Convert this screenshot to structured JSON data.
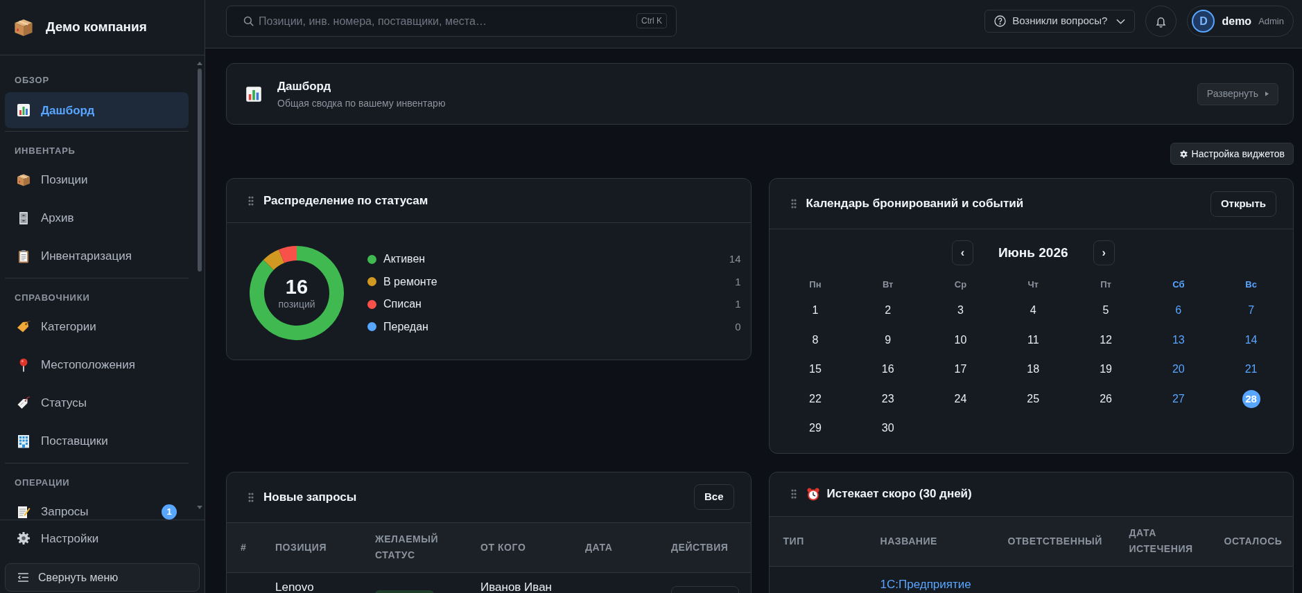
{
  "sidebar": {
    "brand": "Демо компания",
    "sections": [
      {
        "title": "ОБЗОР",
        "items": [
          {
            "label": "Дашборд",
            "selected": true
          }
        ]
      },
      {
        "title": "ИНВЕНТАРЬ",
        "items": [
          {
            "label": "Позиции",
            "selected": false
          },
          {
            "label": "Архив",
            "selected": false
          },
          {
            "label": "Инвентаризация",
            "selected": false
          }
        ]
      },
      {
        "title": "СПРАВОЧНИКИ",
        "items": [
          {
            "label": "Категории",
            "selected": false
          },
          {
            "label": "Местоположения",
            "selected": false
          },
          {
            "label": "Статусы",
            "selected": false
          },
          {
            "label": "Поставщики",
            "selected": false
          }
        ]
      },
      {
        "title": "ОПЕРАЦИИ",
        "items": [
          {
            "label": "Запросы",
            "selected": false,
            "badge": "1"
          }
        ]
      }
    ],
    "settings": {
      "label": "Настройки",
      "selected": false
    },
    "collapse_button": "Свернуть меню"
  },
  "top_bar": {
    "search": {
      "placeholder": "Позиции, инв. номера, поставщики, места…",
      "shortcut": "Ctrl K"
    },
    "help_button": "Возникли вопросы?",
    "user": {
      "initial": "D",
      "name": "demo",
      "role": "Admin"
    }
  },
  "page_header": {
    "title": "Дашборд",
    "subtitle": "Общая сводка по вашему инвентарю",
    "expand_button": "Развернуть"
  },
  "widget_settings_button": "Настройка виджетов",
  "status_widget": {
    "title": "Распределение по статусам",
    "total": "16",
    "total_label": "позиций",
    "legend": [
      {
        "label": "Активен",
        "count": "14",
        "color": "#3fb950"
      },
      {
        "label": "В ремонте",
        "count": "1",
        "color": "#d29922"
      },
      {
        "label": "Списан",
        "count": "1",
        "color": "#f85149"
      },
      {
        "label": "Передан",
        "count": "0",
        "color": "#58a6ff"
      }
    ],
    "chart_data": {
      "type": "donut",
      "values": [
        87.5,
        6.25,
        6.25,
        0
      ]
    }
  },
  "calendar_widget": {
    "title": "Календарь бронирований и событий",
    "open_button": "Открыть",
    "prev_button": "‹",
    "month": "Июнь 2026",
    "next_button": "›",
    "weekdays": [
      {
        "label": "Пн",
        "weekend": false
      },
      {
        "label": "Вт",
        "weekend": false
      },
      {
        "label": "Ср",
        "weekend": false
      },
      {
        "label": "Чт",
        "weekend": false
      },
      {
        "label": "Пт",
        "weekend": false
      },
      {
        "label": "Сб",
        "weekend": true
      },
      {
        "label": "Вс",
        "weekend": true
      }
    ],
    "weeks": [
      [
        {
          "label": "1",
          "today": false
        },
        {
          "label": "2",
          "today": false
        },
        {
          "label": "3",
          "today": false
        },
        {
          "label": "4",
          "today": false
        },
        {
          "label": "5",
          "today": false
        },
        {
          "label": "6",
          "today": false
        },
        {
          "label": "7",
          "today": false
        }
      ],
      [
        {
          "label": "8",
          "today": false
        },
        {
          "label": "9",
          "today": false
        },
        {
          "label": "10",
          "today": false
        },
        {
          "label": "11",
          "today": false
        },
        {
          "label": "12",
          "today": false
        },
        {
          "label": "13",
          "today": false
        },
        {
          "label": "14",
          "today": false
        }
      ],
      [
        {
          "label": "15",
          "today": false
        },
        {
          "label": "16",
          "today": false
        },
        {
          "label": "17",
          "today": false
        },
        {
          "label": "18",
          "today": false
        },
        {
          "label": "19",
          "today": false
        },
        {
          "label": "20",
          "today": false
        },
        {
          "label": "21",
          "today": false
        }
      ],
      [
        {
          "label": "22",
          "today": false
        },
        {
          "label": "23",
          "today": false
        },
        {
          "label": "24",
          "today": false
        },
        {
          "label": "25",
          "today": false
        },
        {
          "label": "26",
          "today": false
        },
        {
          "label": "27",
          "today": false
        },
        {
          "label": "28",
          "today": true
        }
      ],
      [
        {
          "label": "29",
          "today": false
        },
        {
          "label": "30",
          "today": false
        }
      ]
    ]
  },
  "requests_widget": {
    "title": "Новые запросы",
    "all_button": "Все",
    "columns": [
      "#",
      "ПОЗИЦИЯ",
      "ЖЕЛАЕМЫЙ СТАТУС",
      "ОТ КОГО",
      "ДАТА",
      "ДЕЙСТВИЯ"
    ],
    "rows": [
      {
        "position": "Lenovo",
        "from": "Иванов Иван"
      }
    ]
  },
  "expiring_widget": {
    "title": "Истекает скоро (30 дней)",
    "columns": [
      "ТИП",
      "НАЗВАНИЕ",
      "ОТВЕТСТВЕННЫЙ",
      "ДАТА ИСТЕЧЕНИЯ",
      "ОСТАЛОСЬ"
    ],
    "rows": [
      {
        "name": "1С:Предприятие"
      }
    ]
  }
}
